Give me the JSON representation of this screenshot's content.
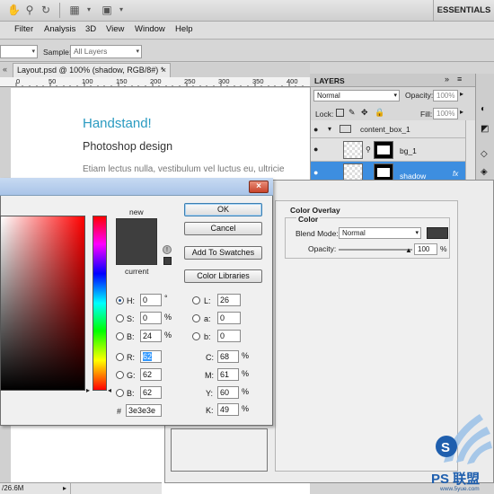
{
  "app": {
    "workspace": "ESSENTIALS",
    "menus": [
      "Filter",
      "Analysis",
      "3D",
      "View",
      "Window",
      "Help"
    ],
    "options": {
      "sample_label": "Sample:",
      "sample_value": "All Layers"
    }
  },
  "document": {
    "tab_title": "Layout.psd @ 100% (shadow, RGB/8#) *",
    "ruler_numbers": [
      "0",
      "50",
      "100",
      "150",
      "200",
      "250",
      "300",
      "350",
      "400"
    ],
    "canvas": {
      "heading": "Handstand!",
      "subheading": "Photoshop design",
      "body": "Etiam lectus nulla, vestibulum vel luctus eu, ultricie"
    },
    "status_text": "/26.6M"
  },
  "layers_panel": {
    "title": "LAYERS",
    "blend_mode": "Normal",
    "opacity_label": "Opacity:",
    "opacity_value": "100%",
    "lock_label": "Lock:",
    "fill_label": "Fill:",
    "fill_value": "100%",
    "layers": [
      {
        "name": "content_box_1",
        "type": "group"
      },
      {
        "name": "bg_1",
        "type": "layer"
      },
      {
        "name": "shadow",
        "type": "layer",
        "selected": true
      }
    ]
  },
  "color_picker": {
    "new_label": "new",
    "current_label": "current",
    "new_color": "#3e3e3e",
    "current_color": "#3e3e3e",
    "buttons": {
      "ok": "OK",
      "cancel": "Cancel",
      "add_swatches": "Add To Swatches",
      "color_libraries": "Color Libraries"
    },
    "hsb": {
      "h": "0",
      "s": "0",
      "b": "24",
      "h_unit": "°",
      "s_unit": "%",
      "b_unit": "%"
    },
    "rgb": {
      "r": "62",
      "g": "62",
      "b": "62"
    },
    "lab": {
      "l": "26",
      "a": "0",
      "b": "0"
    },
    "cmyk": {
      "c": "68",
      "m": "61",
      "y": "60",
      "k": "49"
    },
    "hex": "3e3e3e",
    "labels": {
      "h": "H:",
      "s": "S:",
      "b": "B:",
      "r": "R:",
      "g": "G:",
      "bb": "B:",
      "l": "L:",
      "a": "a:",
      "lab_b": "b:",
      "c": "C:",
      "m": "M:",
      "y": "Y:",
      "k": "K:",
      "hash": "#",
      "pct": "%"
    }
  },
  "layer_style": {
    "section_title": "Color Overlay",
    "group_title": "Color",
    "blend_mode_label": "Blend Mode:",
    "blend_mode_value": "Normal",
    "opacity_label": "Opacity:",
    "opacity_value": "100",
    "opacity_unit": "%",
    "overlay_color": "#3e3e3e"
  },
  "watermark": {
    "text": "PS 联盟",
    "url": "www.5yue.com"
  }
}
